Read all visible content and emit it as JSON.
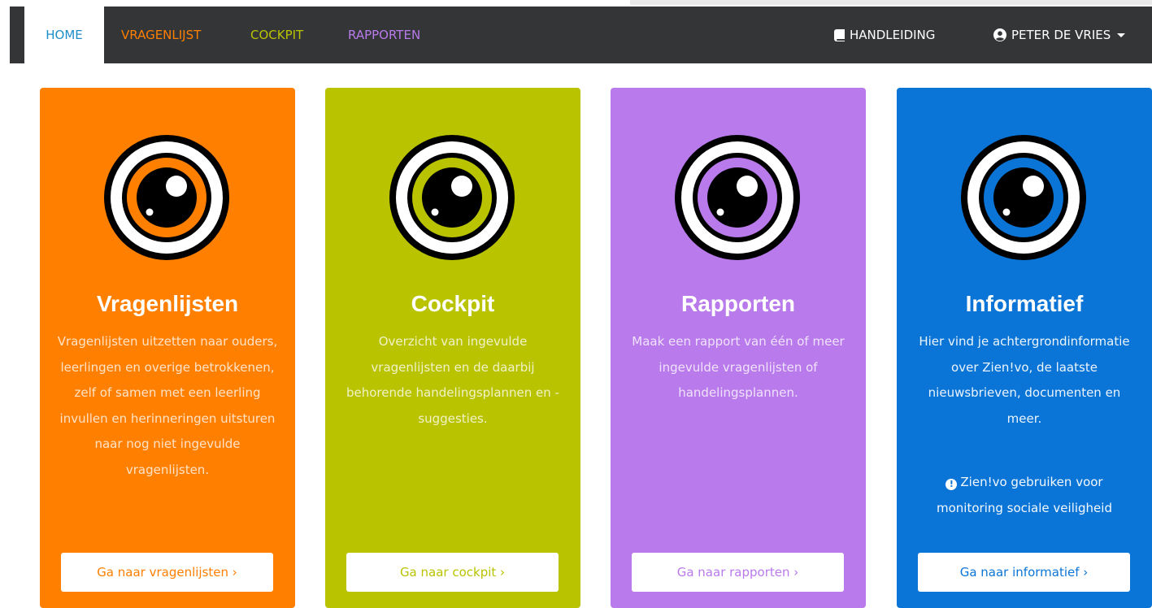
{
  "nav": {
    "home": "HOME",
    "vragenlijst": "VRAGENLIJST",
    "cockpit": "COCKPIT",
    "rapporten": "RAPPORTEN",
    "handleiding": "HANDLEIDING",
    "user": "PETER DE VRIES",
    "home_color": "#1e8ec9",
    "vragenlijst_color": "#ff7f00",
    "cockpit_color": "#b9c300",
    "rapporten_color": "#b97aec"
  },
  "cards": [
    {
      "title": "Vragenlijsten",
      "desc": "Vragenlijsten uitzetten naar ouders, leerlingen en overige betrokkenen, zelf of samen met een leerling invullen en herinneringen uitsturen naar nog niet ingevulde vragenlijsten.",
      "button": "Ga naar vragenlijsten ›",
      "color": "#ff7f00"
    },
    {
      "title": "Cockpit",
      "desc": "Overzicht van ingevulde vragenlijsten en de daarbij behorende handelingsplannen en -suggesties.",
      "button": "Ga naar cockpit ›",
      "color": "#b9c300"
    },
    {
      "title": "Rapporten",
      "desc": "Maak een rapport van één of meer ingevulde vragenlijsten of handelingsplannen.",
      "button": "Ga naar rapporten ›",
      "color": "#b97aec"
    },
    {
      "title": "Informatief",
      "desc": "Hier vind je achtergrondinformatie over Zien!vo, de laatste nieuwsbrieven, documenten en meer.",
      "note": "Zien!vo gebruiken voor monitoring sociale veiligheid",
      "button": "Ga naar informatief ›",
      "color": "#0a75d6"
    }
  ]
}
